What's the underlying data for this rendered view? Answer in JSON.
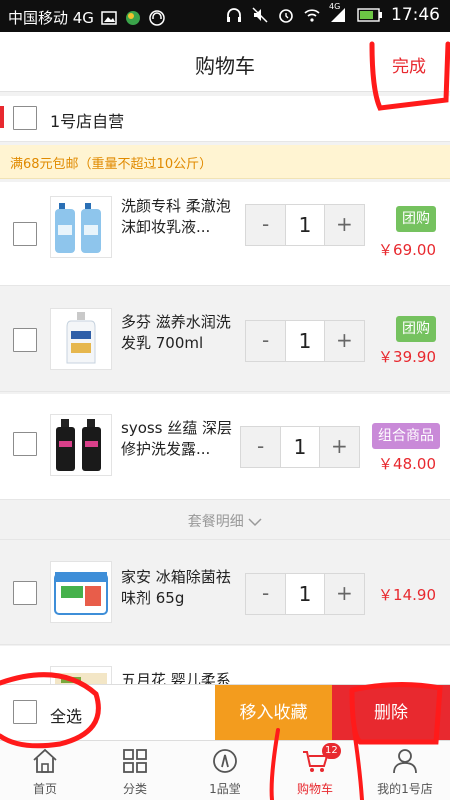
{
  "status_bar": {
    "carrier": "中国移动 4G",
    "network_badge": "4G",
    "time": "17:46",
    "icons": [
      "image-icon",
      "ball-icon",
      "headset-icon",
      "headphones-icon",
      "mute-icon",
      "alarm-icon",
      "wifi-icon",
      "signal-icon",
      "battery-icon"
    ]
  },
  "header": {
    "title": "购物车",
    "done_label": "完成"
  },
  "store": {
    "name": "1号店自营"
  },
  "shipping_notice": "满68元包邮（重量不超过10公斤）",
  "items": [
    {
      "name": "洗颜专科 柔澈泡沫卸妆乳液...",
      "quantity": "1",
      "badge": "团购",
      "price": "￥69.00",
      "image": "face-wash-bottles"
    },
    {
      "name": "多芬 滋养水润洗发乳 700ml",
      "quantity": "1",
      "badge": "团购",
      "price": "￥39.90",
      "image": "shampoo-bottle"
    },
    {
      "name": "syoss 丝蕴 深层修护洗发露...",
      "quantity": "1",
      "badge": "组合商品",
      "price": "￥48.00",
      "image": "black-bottles"
    },
    {
      "name": "家安 冰箱除菌祛味剂 65g",
      "quantity": "1",
      "price": "￥14.90",
      "image": "fridge-deodorant"
    },
    {
      "name": "五月花 婴儿柔系",
      "image": "tissue-pack"
    }
  ],
  "stepper": {
    "minus": "-",
    "plus": "+"
  },
  "combo_details": "套餐明细",
  "bottom_bar": {
    "select_all": "全选",
    "move_to_favorites": "移入收藏",
    "delete": "删除"
  },
  "tab_bar": {
    "tabs": [
      {
        "label": "首页",
        "icon": "home-icon"
      },
      {
        "label": "分类",
        "icon": "category-icon"
      },
      {
        "label": "1品堂",
        "icon": "compass-icon"
      },
      {
        "label": "购物车",
        "icon": "cart-icon",
        "active": true,
        "count": "12"
      },
      {
        "label": "我的1号店",
        "icon": "user-icon"
      }
    ]
  },
  "colors": {
    "accent_red": "#e8292f",
    "favorite_orange": "#f39c1e",
    "badge_green": "#75c25f",
    "badge_purple": "#c98ad8",
    "notice_bg": "#fff4d2"
  }
}
